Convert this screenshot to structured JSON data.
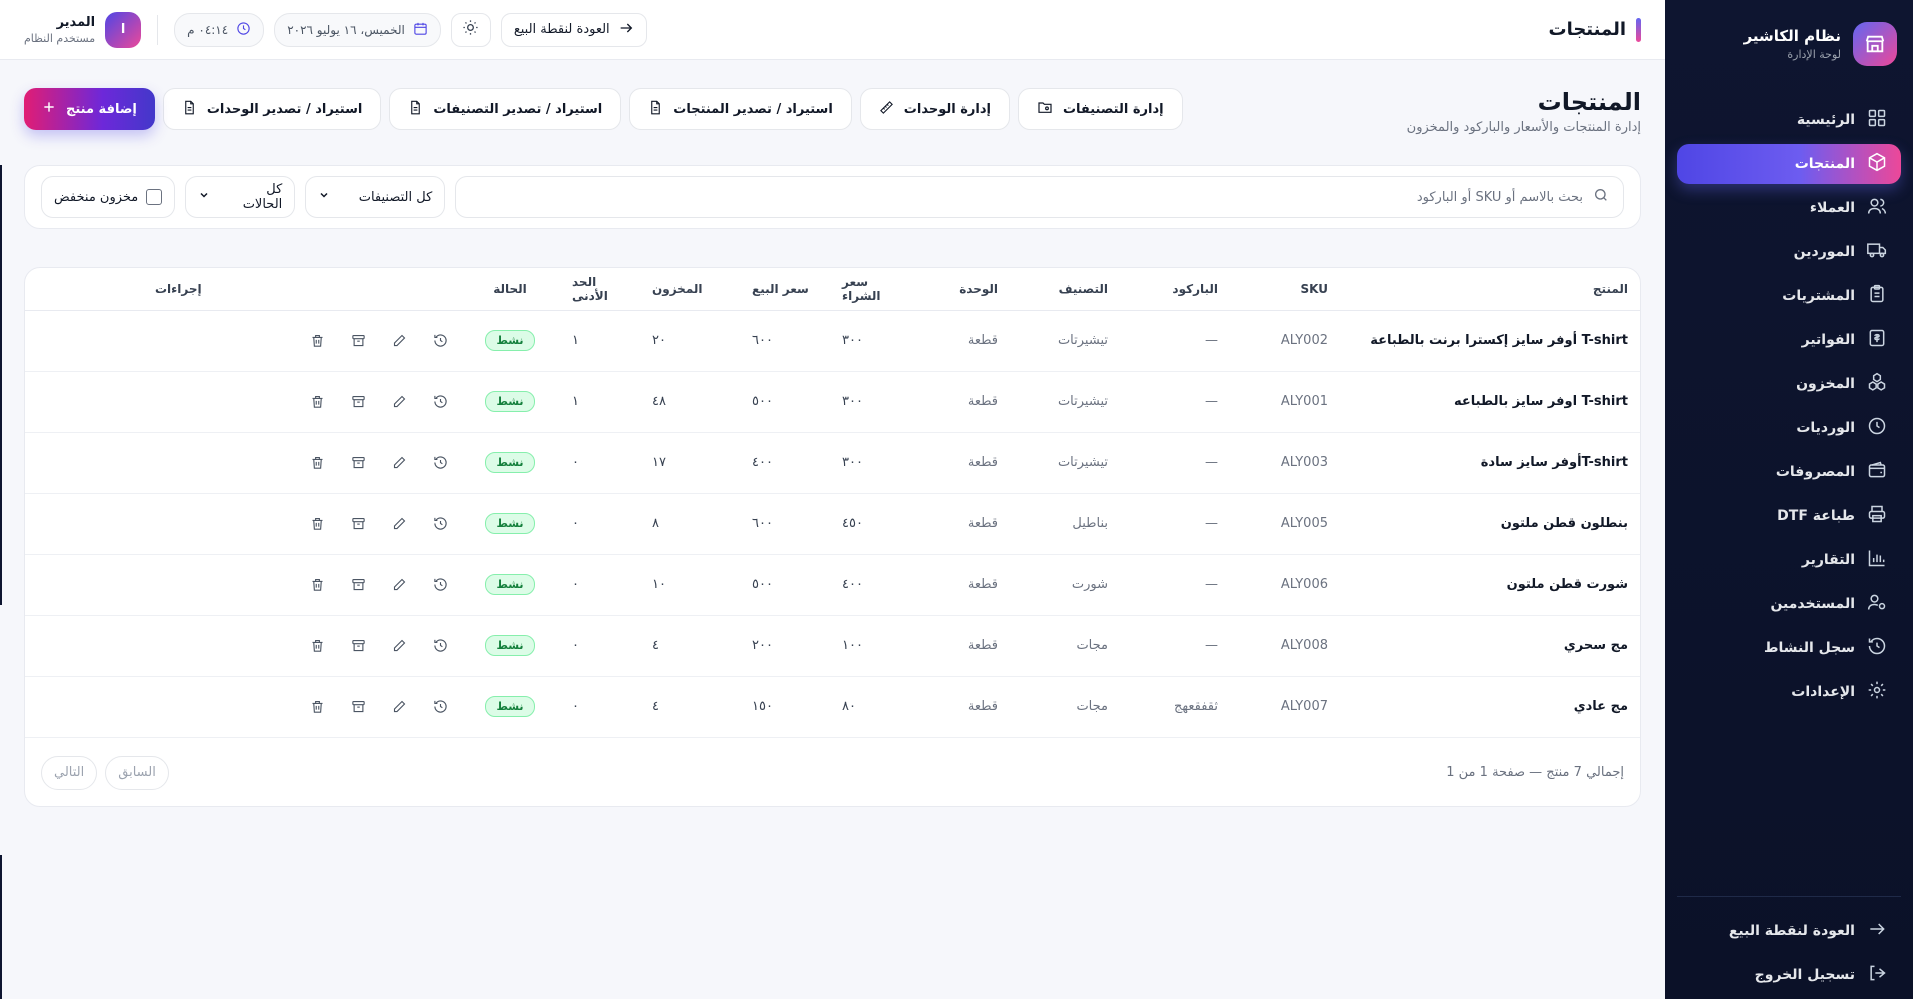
{
  "brand": {
    "title": "نظام الكاشير",
    "subtitle": "لوحة الإدارة",
    "icon": "store-icon"
  },
  "nav": [
    {
      "label": "الرئيسية",
      "icon": "grid-icon",
      "active": false
    },
    {
      "label": "المنتجات",
      "icon": "box-icon",
      "active": true
    },
    {
      "label": "العملاء",
      "icon": "users-icon",
      "active": false
    },
    {
      "label": "الموردين",
      "icon": "truck-icon",
      "active": false
    },
    {
      "label": "المشتريات",
      "icon": "clipboard-icon",
      "active": false
    },
    {
      "label": "الفواتير",
      "icon": "invoice-icon",
      "active": false
    },
    {
      "label": "المخزون",
      "icon": "boxes-icon",
      "active": false
    },
    {
      "label": "الورديات",
      "icon": "clock-icon",
      "active": false
    },
    {
      "label": "المصروفات",
      "icon": "wallet-icon",
      "active": false
    },
    {
      "label": "طباعة DTF",
      "icon": "printer-icon",
      "active": false
    },
    {
      "label": "التقارير",
      "icon": "chart-icon",
      "active": false
    },
    {
      "label": "المستخدمين",
      "icon": "user-cog-icon",
      "active": false
    },
    {
      "label": "سجل النشاط",
      "icon": "history-icon",
      "active": false
    },
    {
      "label": "الإعدادات",
      "icon": "gear-icon",
      "active": false
    }
  ],
  "sidebar_footer": {
    "back_pos": "العودة لنقطة البيع",
    "logout": "تسجيل الخروج"
  },
  "header": {
    "title": "المنتجات",
    "back_pos": "العودة لنقطة البيع",
    "date": "الخميس، ١٦ يوليو ٢٠٢٦",
    "time": "٠٤:١٤ م",
    "user_initial": "ا",
    "user_name": "المدير",
    "user_role": "مستخدم النظام"
  },
  "page": {
    "title": "المنتجات",
    "subtitle": "إدارة المنتجات والأسعار والباركود والمخزون",
    "buttons": {
      "manage_categories": "إدارة التصنيفات",
      "manage_units": "إدارة الوحدات",
      "import_products": "استيراد / تصدير المنتجات",
      "import_categories": "استيراد / تصدير التصنيفات",
      "import_units": "استيراد / تصدير الوحدات",
      "add_product": "إضافة منتج"
    }
  },
  "filters": {
    "search_placeholder": "بحث بالاسم أو SKU أو الباركود",
    "category": "كل التصنيفات",
    "status": "كل الحالات",
    "low_stock": "مخزون منخفض"
  },
  "table": {
    "headers": {
      "product": "المنتج",
      "sku": "SKU",
      "barcode": "الباركود",
      "category": "التصنيف",
      "unit": "الوحدة",
      "purchase": "سعر الشراء",
      "sale": "سعر البيع",
      "stock": "المخزون",
      "min": "الحد الأدنى",
      "status": "الحالة",
      "actions": "إجراءات"
    },
    "rows": [
      {
        "product": "T-shirt أوفر سايز إكسترا برنت بالطباعة",
        "sku": "ALY002",
        "barcode": "—",
        "category": "تيشيرتات",
        "unit": "قطعة",
        "purchase": "٣٠٠",
        "sale": "٦٠٠",
        "stock": "٢٠",
        "min": "١",
        "status": "نشط"
      },
      {
        "product": "T-shirt اوفر سايز بالطباعه",
        "sku": "ALY001",
        "barcode": "—",
        "category": "تيشيرتات",
        "unit": "قطعة",
        "purchase": "٣٠٠",
        "sale": "٥٠٠",
        "stock": "٤٨",
        "min": "١",
        "status": "نشط"
      },
      {
        "product": "T-shirtأوفر سايز سادة",
        "sku": "ALY003",
        "barcode": "—",
        "category": "تيشيرتات",
        "unit": "قطعة",
        "purchase": "٣٠٠",
        "sale": "٤٠٠",
        "stock": "١٧",
        "min": "٠",
        "status": "نشط"
      },
      {
        "product": "بنطلون قطن ملتون",
        "sku": "ALY005",
        "barcode": "—",
        "category": "بناطيل",
        "unit": "قطعة",
        "purchase": "٤٥٠",
        "sale": "٦٠٠",
        "stock": "٨",
        "min": "٠",
        "status": "نشط"
      },
      {
        "product": "شورت قطن ملتون",
        "sku": "ALY006",
        "barcode": "—",
        "category": "شورت",
        "unit": "قطعة",
        "purchase": "٤٠٠",
        "sale": "٥٠٠",
        "stock": "١٠",
        "min": "٠",
        "status": "نشط"
      },
      {
        "product": "مج سحري",
        "sku": "ALY008",
        "barcode": "—",
        "category": "مجات",
        "unit": "قطعة",
        "purchase": "١٠٠",
        "sale": "٢٠٠",
        "stock": "٤",
        "min": "٠",
        "status": "نشط"
      },
      {
        "product": "مج عادي",
        "sku": "ALY007",
        "barcode": "ثقفقعهج",
        "category": "مجات",
        "unit": "قطعة",
        "purchase": "٨٠",
        "sale": "١٥٠",
        "stock": "٤",
        "min": "٠",
        "status": "نشط"
      }
    ],
    "footer_text": "إجمالي 7 منتج — صفحة 1 من 1",
    "prev": "السابق",
    "next": "التالي"
  },
  "colors": {
    "sidebar": "#0e1530",
    "accent_start": "#4f46e5",
    "accent_end": "#ec4899",
    "active_badge": "#15803d"
  }
}
